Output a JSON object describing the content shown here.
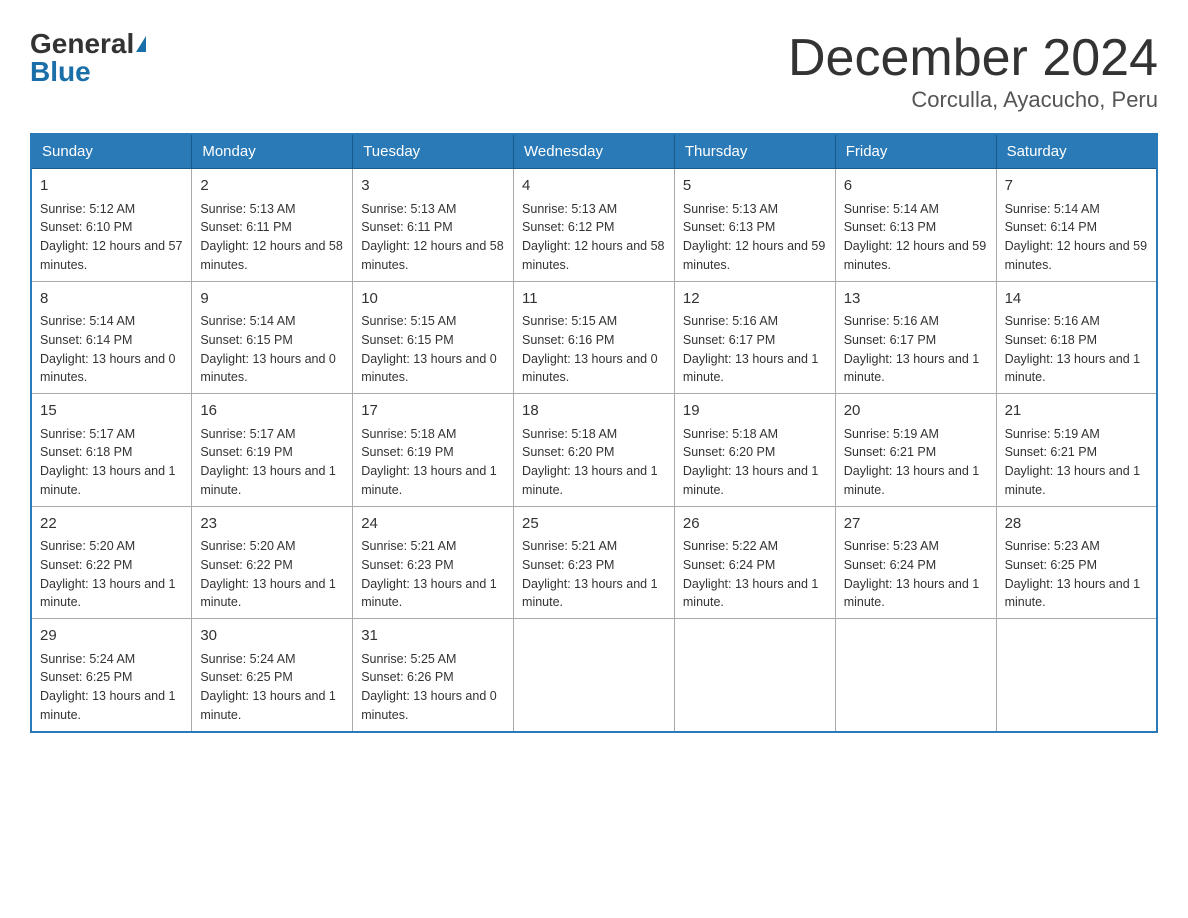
{
  "header": {
    "logo_general": "General",
    "logo_blue": "Blue",
    "month_title": "December 2024",
    "location": "Corculla, Ayacucho, Peru"
  },
  "days_of_week": [
    "Sunday",
    "Monday",
    "Tuesday",
    "Wednesday",
    "Thursday",
    "Friday",
    "Saturday"
  ],
  "weeks": [
    [
      {
        "day": "1",
        "sunrise": "5:12 AM",
        "sunset": "6:10 PM",
        "daylight": "12 hours and 57 minutes."
      },
      {
        "day": "2",
        "sunrise": "5:13 AM",
        "sunset": "6:11 PM",
        "daylight": "12 hours and 58 minutes."
      },
      {
        "day": "3",
        "sunrise": "5:13 AM",
        "sunset": "6:11 PM",
        "daylight": "12 hours and 58 minutes."
      },
      {
        "day": "4",
        "sunrise": "5:13 AM",
        "sunset": "6:12 PM",
        "daylight": "12 hours and 58 minutes."
      },
      {
        "day": "5",
        "sunrise": "5:13 AM",
        "sunset": "6:13 PM",
        "daylight": "12 hours and 59 minutes."
      },
      {
        "day": "6",
        "sunrise": "5:14 AM",
        "sunset": "6:13 PM",
        "daylight": "12 hours and 59 minutes."
      },
      {
        "day": "7",
        "sunrise": "5:14 AM",
        "sunset": "6:14 PM",
        "daylight": "12 hours and 59 minutes."
      }
    ],
    [
      {
        "day": "8",
        "sunrise": "5:14 AM",
        "sunset": "6:14 PM",
        "daylight": "13 hours and 0 minutes."
      },
      {
        "day": "9",
        "sunrise": "5:14 AM",
        "sunset": "6:15 PM",
        "daylight": "13 hours and 0 minutes."
      },
      {
        "day": "10",
        "sunrise": "5:15 AM",
        "sunset": "6:15 PM",
        "daylight": "13 hours and 0 minutes."
      },
      {
        "day": "11",
        "sunrise": "5:15 AM",
        "sunset": "6:16 PM",
        "daylight": "13 hours and 0 minutes."
      },
      {
        "day": "12",
        "sunrise": "5:16 AM",
        "sunset": "6:17 PM",
        "daylight": "13 hours and 1 minute."
      },
      {
        "day": "13",
        "sunrise": "5:16 AM",
        "sunset": "6:17 PM",
        "daylight": "13 hours and 1 minute."
      },
      {
        "day": "14",
        "sunrise": "5:16 AM",
        "sunset": "6:18 PM",
        "daylight": "13 hours and 1 minute."
      }
    ],
    [
      {
        "day": "15",
        "sunrise": "5:17 AM",
        "sunset": "6:18 PM",
        "daylight": "13 hours and 1 minute."
      },
      {
        "day": "16",
        "sunrise": "5:17 AM",
        "sunset": "6:19 PM",
        "daylight": "13 hours and 1 minute."
      },
      {
        "day": "17",
        "sunrise": "5:18 AM",
        "sunset": "6:19 PM",
        "daylight": "13 hours and 1 minute."
      },
      {
        "day": "18",
        "sunrise": "5:18 AM",
        "sunset": "6:20 PM",
        "daylight": "13 hours and 1 minute."
      },
      {
        "day": "19",
        "sunrise": "5:18 AM",
        "sunset": "6:20 PM",
        "daylight": "13 hours and 1 minute."
      },
      {
        "day": "20",
        "sunrise": "5:19 AM",
        "sunset": "6:21 PM",
        "daylight": "13 hours and 1 minute."
      },
      {
        "day": "21",
        "sunrise": "5:19 AM",
        "sunset": "6:21 PM",
        "daylight": "13 hours and 1 minute."
      }
    ],
    [
      {
        "day": "22",
        "sunrise": "5:20 AM",
        "sunset": "6:22 PM",
        "daylight": "13 hours and 1 minute."
      },
      {
        "day": "23",
        "sunrise": "5:20 AM",
        "sunset": "6:22 PM",
        "daylight": "13 hours and 1 minute."
      },
      {
        "day": "24",
        "sunrise": "5:21 AM",
        "sunset": "6:23 PM",
        "daylight": "13 hours and 1 minute."
      },
      {
        "day": "25",
        "sunrise": "5:21 AM",
        "sunset": "6:23 PM",
        "daylight": "13 hours and 1 minute."
      },
      {
        "day": "26",
        "sunrise": "5:22 AM",
        "sunset": "6:24 PM",
        "daylight": "13 hours and 1 minute."
      },
      {
        "day": "27",
        "sunrise": "5:23 AM",
        "sunset": "6:24 PM",
        "daylight": "13 hours and 1 minute."
      },
      {
        "day": "28",
        "sunrise": "5:23 AM",
        "sunset": "6:25 PM",
        "daylight": "13 hours and 1 minute."
      }
    ],
    [
      {
        "day": "29",
        "sunrise": "5:24 AM",
        "sunset": "6:25 PM",
        "daylight": "13 hours and 1 minute."
      },
      {
        "day": "30",
        "sunrise": "5:24 AM",
        "sunset": "6:25 PM",
        "daylight": "13 hours and 1 minute."
      },
      {
        "day": "31",
        "sunrise": "5:25 AM",
        "sunset": "6:26 PM",
        "daylight": "13 hours and 0 minutes."
      },
      null,
      null,
      null,
      null
    ]
  ],
  "labels": {
    "sunrise": "Sunrise:",
    "sunset": "Sunset:",
    "daylight": "Daylight:"
  }
}
